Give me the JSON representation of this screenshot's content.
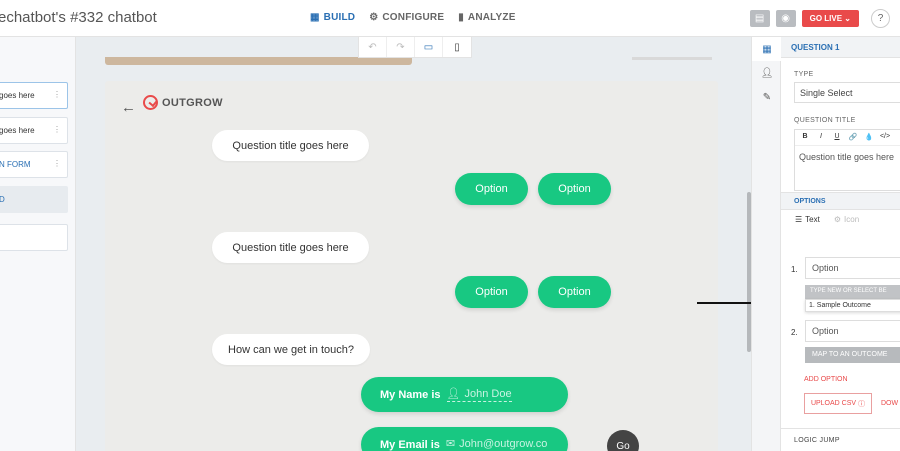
{
  "app": {
    "title": "echatbot's #332 chatbot"
  },
  "nav": [
    {
      "label": "BUILD",
      "icon": "grid-icon"
    },
    {
      "label": "CONFIGURE",
      "icon": "gear-icon"
    },
    {
      "label": "ANALYZE",
      "icon": "bar-chart-icon"
    }
  ],
  "top_actions": {
    "go_live": "GO LIVE",
    "help": "?"
  },
  "left_sidebar": {
    "items": [
      {
        "label": "goes here"
      },
      {
        "label": "goes here"
      },
      {
        "label": "N FORM"
      },
      {
        "label": "D"
      },
      {
        "label": ""
      }
    ]
  },
  "canvas": {
    "logo_text": "OUTGROW",
    "messages": [
      "Question title goes here",
      "Question title goes here",
      "How can we get in touch?"
    ],
    "options": [
      "Option",
      "Option",
      "Option",
      "Option"
    ],
    "fields": [
      {
        "label": "My Name is",
        "placeholder": "John Doe"
      },
      {
        "label": "My Email is",
        "placeholder": "John@outgrow.co"
      }
    ],
    "go_label": "Go"
  },
  "properties": {
    "header": "QUESTION 1",
    "type_label": "TYPE",
    "type_value": "Single Select",
    "question_title_label": "QUESTION TITLE",
    "editor_tools": [
      "B",
      "I",
      "U",
      "🔗",
      "💧",
      "</>"
    ],
    "question_title_value": "Question title goes here",
    "options_label": "OPTIONS",
    "mode_text": "Text",
    "mode_icon": "Icon",
    "options": [
      {
        "number": "1.",
        "value": "Option"
      },
      {
        "number": "2.",
        "value": "Option"
      }
    ],
    "type_new_placeholder": "TYPE NEW OR SELECT BE",
    "outcome_option": "1. Sample Outcome",
    "map_outcome": "MAP TO AN OUTCOME",
    "add_option": "ADD OPTION",
    "upload_csv": "UPLOAD CSV",
    "download": "DOW",
    "logic_jump": "LOGIC JUMP"
  },
  "colors": {
    "accent": "#2a6fb3",
    "option_green": "#18c882",
    "go_live_red": "#e94a4a"
  }
}
